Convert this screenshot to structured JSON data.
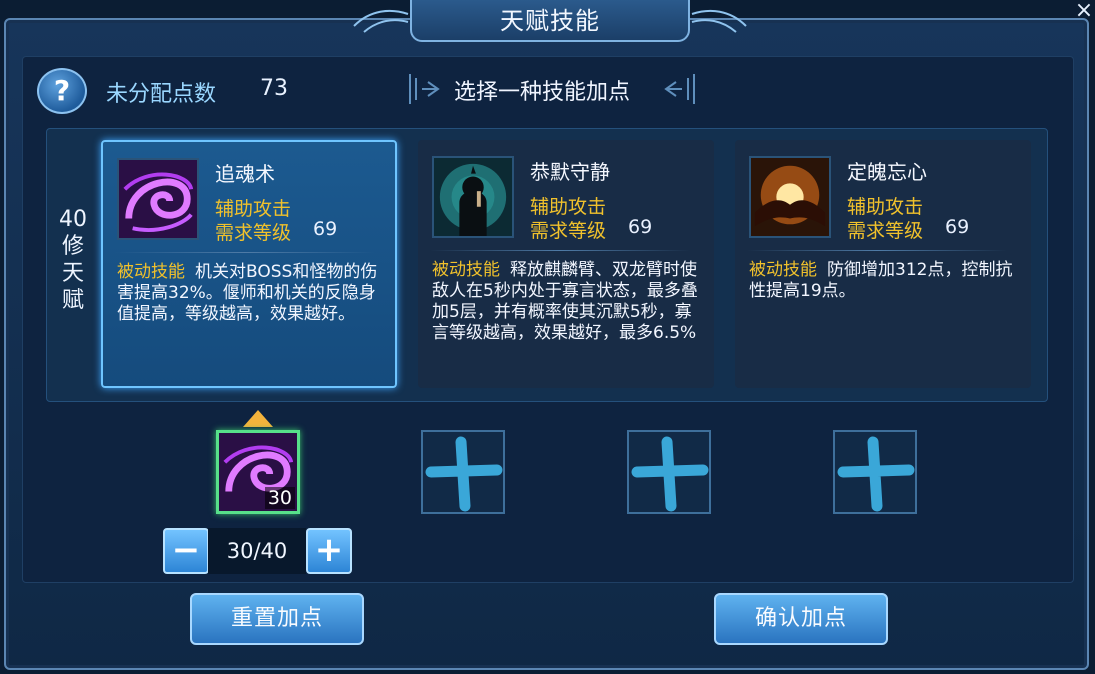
{
  "window": {
    "title": "天赋技能",
    "close_icon": "×"
  },
  "header": {
    "help_icon": "?",
    "unallocated_label": "未分配点数",
    "unallocated_points": "73",
    "select_prompt": "选择一种技能加点"
  },
  "tier": {
    "label": "40修天赋",
    "chars": [
      "40",
      "修",
      "天",
      "赋"
    ]
  },
  "skills": [
    {
      "name": "追魂术",
      "type": "辅助攻击",
      "req_label": "需求等级",
      "req_level": "69",
      "desc_keyword": "被动技能",
      "desc": "机关对BOSS和怪物的伤害提高32%。偃师和机关的反隐身值提高，等级越高，效果越好。",
      "icon": "purple-swirl-icon",
      "selected": true
    },
    {
      "name": "恭默守静",
      "type": "辅助攻击",
      "req_label": "需求等级",
      "req_level": "69",
      "desc_keyword": "被动技能",
      "desc": "释放麒麟臂、双龙臂时使敌人在5秒内处于寡言状态，最多叠加5层，并有概率使其沉默5秒，寡言等级越高，效果越好，最多6.5%",
      "icon": "silent-monk-icon",
      "selected": false
    },
    {
      "name": "定魄忘心",
      "type": "辅助攻击",
      "req_label": "需求等级",
      "req_level": "69",
      "desc_keyword": "被动技能",
      "desc": "防御增加312点，控制抗性提高19点。",
      "icon": "glowing-hands-icon",
      "selected": false
    }
  ],
  "slots": [
    {
      "state": "filled",
      "level": "30",
      "icon": "purple-swirl-icon"
    },
    {
      "state": "empty",
      "icon": "plus-icon"
    },
    {
      "state": "empty",
      "icon": "plus-icon"
    },
    {
      "state": "empty",
      "icon": "plus-icon"
    }
  ],
  "stepper": {
    "value": "30/40",
    "minus": "−",
    "plus": "+"
  },
  "buttons": {
    "reset": "重置加点",
    "confirm": "确认加点"
  },
  "colors": {
    "accent_gold": "#f0c12c",
    "label_cyan": "#9ad7ff",
    "selected_border": "#6fc5ff",
    "slot_filled_border": "#57e08a"
  }
}
